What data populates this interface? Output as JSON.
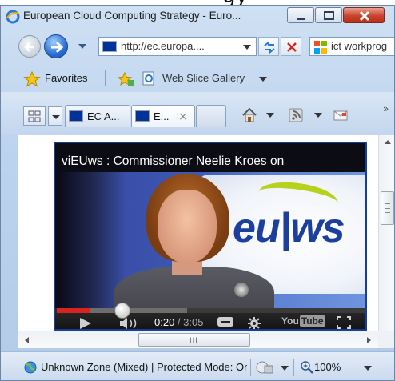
{
  "window": {
    "title": "European Cloud Computing Strategy - Euro...",
    "top_cut_text": "gy"
  },
  "navigation": {
    "address": "http://ec.europa....",
    "search": "ict workprog"
  },
  "favorites_bar": {
    "favorites_label": "Favorites",
    "web_slice_label": "Web Slice Gallery"
  },
  "tabs": [
    {
      "label": "EC A...",
      "active": false
    },
    {
      "label": "E...",
      "active": true
    }
  ],
  "tab_close_glyph": "×",
  "tab_overflow_glyph": "»",
  "video": {
    "title": "viEUws : Commissioner Neelie Kroes on",
    "logo_text": "eu|ws",
    "current_time": "0:20",
    "separator": " / ",
    "duration": "3:05",
    "progress_played": 0.108,
    "progress_buffered": 0.42,
    "brand_word_1": "You",
    "brand_word_2": "Tube"
  },
  "scrollbar": {
    "h_grip": "III"
  },
  "status_bar": {
    "zone": "Unknown Zone (Mixed) | Protected Mode: On",
    "zoom": "100%"
  },
  "icons": [
    "ie-app-icon",
    "minimize-icon",
    "maximize-icon",
    "close-icon",
    "back-arrow-icon",
    "forward-arrow-icon",
    "dropdown-icon",
    "eu-flag-icon",
    "refresh-icon",
    "stop-icon",
    "bing-search-icon",
    "favorites-star-icon",
    "add-favorites-icon",
    "web-slice-icon",
    "quick-tabs-icon",
    "tab-list-icon",
    "home-icon",
    "rss-feed-icon",
    "mail-icon",
    "play-icon",
    "volume-icon",
    "captions-icon",
    "settings-gear-icon",
    "fullscreen-icon",
    "globe-zone-icon",
    "security-icon",
    "zoom-icon"
  ],
  "colors": {
    "accent_blue": "#123f9a",
    "progress_red": "#d8231f",
    "close_red": "#c8432c"
  }
}
